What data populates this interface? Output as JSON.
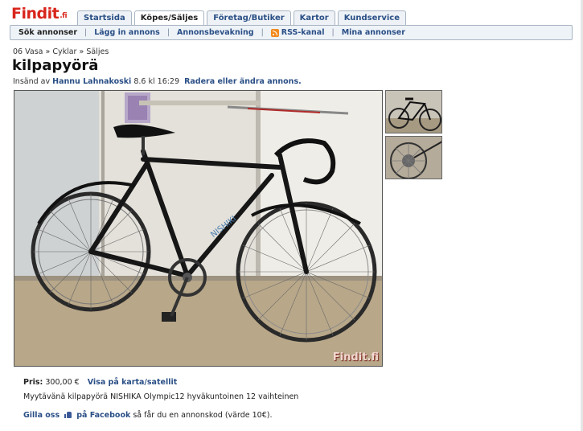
{
  "header": {
    "logo": "Findit",
    "logo_tld": ".fi",
    "tabs": [
      {
        "label": "Startsida",
        "active": false
      },
      {
        "label": "Köpes/Säljes",
        "active": true
      },
      {
        "label": "Företag/Butiker",
        "active": false
      },
      {
        "label": "Kartor",
        "active": false
      },
      {
        "label": "Kundservice",
        "active": false
      }
    ]
  },
  "subnav": {
    "items": [
      {
        "label": "Sök annonser",
        "active": true
      },
      {
        "label": "Lägg in annons"
      },
      {
        "label": "Annonsbevakning"
      },
      {
        "label": "RSS-kanal",
        "icon": "rss-icon"
      },
      {
        "label": "Mina annonser"
      }
    ],
    "separator": "|"
  },
  "breadcrumb": {
    "location": "06 Vasa",
    "category": "Cyklar",
    "type": "Säljes",
    "separator": "»"
  },
  "listing": {
    "title": "kilpapyörä",
    "submitted_prefix": "Insänd av",
    "author": "Hannu Lahnakoski",
    "date": "8.6 kl 16:29",
    "edit_link": "Radera eller ändra annons.",
    "watermark": "Findit.fi",
    "price_label": "Pris:",
    "price_value": "300,00 €",
    "map_link": "Visa på karta/satellit",
    "description": "Myytävänä kilpapyörä NISHIKA Olympic12 hyväkuntoinen 12 vaihteinen"
  },
  "facebook": {
    "link_start": "Gilla oss",
    "link_end": "på Facebook",
    "rest": "så får du en annonskod (värde 10€)."
  },
  "colors": {
    "logo": "#d8261c",
    "link": "#2a4f86",
    "tab_border": "#a7b4c2",
    "subnav_bg": "#eef3f8",
    "facebook": "#3b5998"
  }
}
